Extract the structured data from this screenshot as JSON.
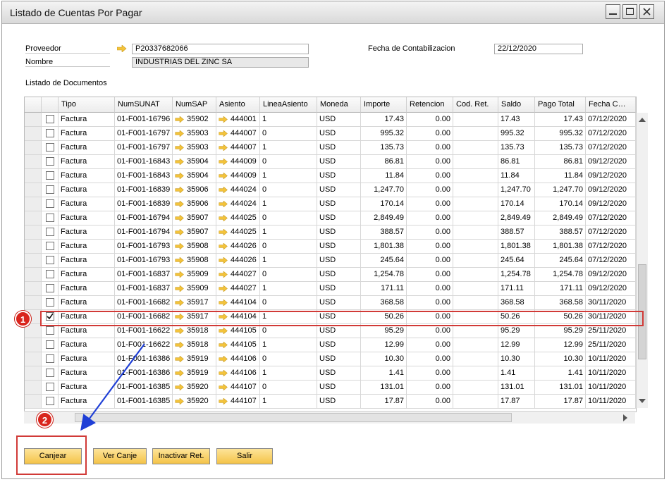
{
  "window": {
    "title": "Listado de Cuentas Por Pagar"
  },
  "form": {
    "proveedor_label": "Proveedor",
    "proveedor_value": "P20337682066",
    "nombre_label": "Nombre",
    "nombre_value": "INDUSTRIAS DEL ZINC SA",
    "fecha_label": "Fecha de Contabilizacion",
    "fecha_value": "22/12/2020",
    "section_label": "Listado de Documentos"
  },
  "grid": {
    "columns": [
      "",
      "Tipo",
      "NumSUNAT",
      "NumSAP",
      "Asiento",
      "LineaAsiento",
      "Moneda",
      "Importe",
      "Retencion",
      "Cod. Ret.",
      "Saldo",
      "Pago Total",
      "Fecha C…"
    ],
    "rows": [
      {
        "checked": false,
        "tipo": "Factura",
        "sunat": "01-F001-16796",
        "sap": "35902",
        "asiento": "444001",
        "linea": "1",
        "moneda": "USD",
        "importe": "17.43",
        "retencion": "0.00",
        "codret": "",
        "saldo": "17.43",
        "pago": "17.43",
        "fecha": "07/12/2020"
      },
      {
        "checked": false,
        "tipo": "Factura",
        "sunat": "01-F001-16797",
        "sap": "35903",
        "asiento": "444007",
        "linea": "0",
        "moneda": "USD",
        "importe": "995.32",
        "retencion": "0.00",
        "codret": "",
        "saldo": "995.32",
        "pago": "995.32",
        "fecha": "07/12/2020"
      },
      {
        "checked": false,
        "tipo": "Factura",
        "sunat": "01-F001-16797",
        "sap": "35903",
        "asiento": "444007",
        "linea": "1",
        "moneda": "USD",
        "importe": "135.73",
        "retencion": "0.00",
        "codret": "",
        "saldo": "135.73",
        "pago": "135.73",
        "fecha": "07/12/2020"
      },
      {
        "checked": false,
        "tipo": "Factura",
        "sunat": "01-F001-16843",
        "sap": "35904",
        "asiento": "444009",
        "linea": "0",
        "moneda": "USD",
        "importe": "86.81",
        "retencion": "0.00",
        "codret": "",
        "saldo": "86.81",
        "pago": "86.81",
        "fecha": "09/12/2020"
      },
      {
        "checked": false,
        "tipo": "Factura",
        "sunat": "01-F001-16843",
        "sap": "35904",
        "asiento": "444009",
        "linea": "1",
        "moneda": "USD",
        "importe": "11.84",
        "retencion": "0.00",
        "codret": "",
        "saldo": "11.84",
        "pago": "11.84",
        "fecha": "09/12/2020"
      },
      {
        "checked": false,
        "tipo": "Factura",
        "sunat": "01-F001-16839",
        "sap": "35906",
        "asiento": "444024",
        "linea": "0",
        "moneda": "USD",
        "importe": "1,247.70",
        "retencion": "0.00",
        "codret": "",
        "saldo": "1,247.70",
        "pago": "1,247.70",
        "fecha": "09/12/2020"
      },
      {
        "checked": false,
        "tipo": "Factura",
        "sunat": "01-F001-16839",
        "sap": "35906",
        "asiento": "444024",
        "linea": "1",
        "moneda": "USD",
        "importe": "170.14",
        "retencion": "0.00",
        "codret": "",
        "saldo": "170.14",
        "pago": "170.14",
        "fecha": "09/12/2020"
      },
      {
        "checked": false,
        "tipo": "Factura",
        "sunat": "01-F001-16794",
        "sap": "35907",
        "asiento": "444025",
        "linea": "0",
        "moneda": "USD",
        "importe": "2,849.49",
        "retencion": "0.00",
        "codret": "",
        "saldo": "2,849.49",
        "pago": "2,849.49",
        "fecha": "07/12/2020"
      },
      {
        "checked": false,
        "tipo": "Factura",
        "sunat": "01-F001-16794",
        "sap": "35907",
        "asiento": "444025",
        "linea": "1",
        "moneda": "USD",
        "importe": "388.57",
        "retencion": "0.00",
        "codret": "",
        "saldo": "388.57",
        "pago": "388.57",
        "fecha": "07/12/2020"
      },
      {
        "checked": false,
        "tipo": "Factura",
        "sunat": "01-F001-16793",
        "sap": "35908",
        "asiento": "444026",
        "linea": "0",
        "moneda": "USD",
        "importe": "1,801.38",
        "retencion": "0.00",
        "codret": "",
        "saldo": "1,801.38",
        "pago": "1,801.38",
        "fecha": "07/12/2020"
      },
      {
        "checked": false,
        "tipo": "Factura",
        "sunat": "01-F001-16793",
        "sap": "35908",
        "asiento": "444026",
        "linea": "1",
        "moneda": "USD",
        "importe": "245.64",
        "retencion": "0.00",
        "codret": "",
        "saldo": "245.64",
        "pago": "245.64",
        "fecha": "07/12/2020"
      },
      {
        "checked": false,
        "tipo": "Factura",
        "sunat": "01-F001-16837",
        "sap": "35909",
        "asiento": "444027",
        "linea": "0",
        "moneda": "USD",
        "importe": "1,254.78",
        "retencion": "0.00",
        "codret": "",
        "saldo": "1,254.78",
        "pago": "1,254.78",
        "fecha": "09/12/2020"
      },
      {
        "checked": false,
        "tipo": "Factura",
        "sunat": "01-F001-16837",
        "sap": "35909",
        "asiento": "444027",
        "linea": "1",
        "moneda": "USD",
        "importe": "171.11",
        "retencion": "0.00",
        "codret": "",
        "saldo": "171.11",
        "pago": "171.11",
        "fecha": "09/12/2020"
      },
      {
        "checked": false,
        "tipo": "Factura",
        "sunat": "01-F001-16682",
        "sap": "35917",
        "asiento": "444104",
        "linea": "0",
        "moneda": "USD",
        "importe": "368.58",
        "retencion": "0.00",
        "codret": "",
        "saldo": "368.58",
        "pago": "368.58",
        "fecha": "30/11/2020"
      },
      {
        "checked": true,
        "tipo": "Factura",
        "sunat": "01-F001-16682",
        "sap": "35917",
        "asiento": "444104",
        "linea": "1",
        "moneda": "USD",
        "importe": "50.26",
        "retencion": "0.00",
        "codret": "",
        "saldo": "50.26",
        "pago": "50.26",
        "fecha": "30/11/2020"
      },
      {
        "checked": false,
        "tipo": "Factura",
        "sunat": "01-F001-16622",
        "sap": "35918",
        "asiento": "444105",
        "linea": "0",
        "moneda": "USD",
        "importe": "95.29",
        "retencion": "0.00",
        "codret": "",
        "saldo": "95.29",
        "pago": "95.29",
        "fecha": "25/11/2020"
      },
      {
        "checked": false,
        "tipo": "Factura",
        "sunat": "01-F001-16622",
        "sap": "35918",
        "asiento": "444105",
        "linea": "1",
        "moneda": "USD",
        "importe": "12.99",
        "retencion": "0.00",
        "codret": "",
        "saldo": "12.99",
        "pago": "12.99",
        "fecha": "25/11/2020"
      },
      {
        "checked": false,
        "tipo": "Factura",
        "sunat": "01-F001-16386",
        "sap": "35919",
        "asiento": "444106",
        "linea": "0",
        "moneda": "USD",
        "importe": "10.30",
        "retencion": "0.00",
        "codret": "",
        "saldo": "10.30",
        "pago": "10.30",
        "fecha": "10/11/2020"
      },
      {
        "checked": false,
        "tipo": "Factura",
        "sunat": "01-F001-16386",
        "sap": "35919",
        "asiento": "444106",
        "linea": "1",
        "moneda": "USD",
        "importe": "1.41",
        "retencion": "0.00",
        "codret": "",
        "saldo": "1.41",
        "pago": "1.41",
        "fecha": "10/11/2020"
      },
      {
        "checked": false,
        "tipo": "Factura",
        "sunat": "01-F001-16385",
        "sap": "35920",
        "asiento": "444107",
        "linea": "0",
        "moneda": "USD",
        "importe": "131.01",
        "retencion": "0.00",
        "codret": "",
        "saldo": "131.01",
        "pago": "131.01",
        "fecha": "10/11/2020"
      },
      {
        "checked": false,
        "tipo": "Factura",
        "sunat": "01-F001-16385",
        "sap": "35920",
        "asiento": "444107",
        "linea": "1",
        "moneda": "USD",
        "importe": "17.87",
        "retencion": "0.00",
        "codret": "",
        "saldo": "17.87",
        "pago": "17.87",
        "fecha": "10/11/2020"
      }
    ]
  },
  "buttons": {
    "canjear": "Canjear",
    "ver_canje": "Ver Canje",
    "inactivar": "Inactivar Ret.",
    "salir": "Salir"
  },
  "annotations": {
    "step1": "1",
    "step2": "2"
  },
  "colors": {
    "link_arrow": "#f3c33b",
    "button": "#f4c348",
    "highlight": "#d13a37",
    "badge": "#d9241c",
    "pointer_arrow": "#1f3fd6"
  }
}
